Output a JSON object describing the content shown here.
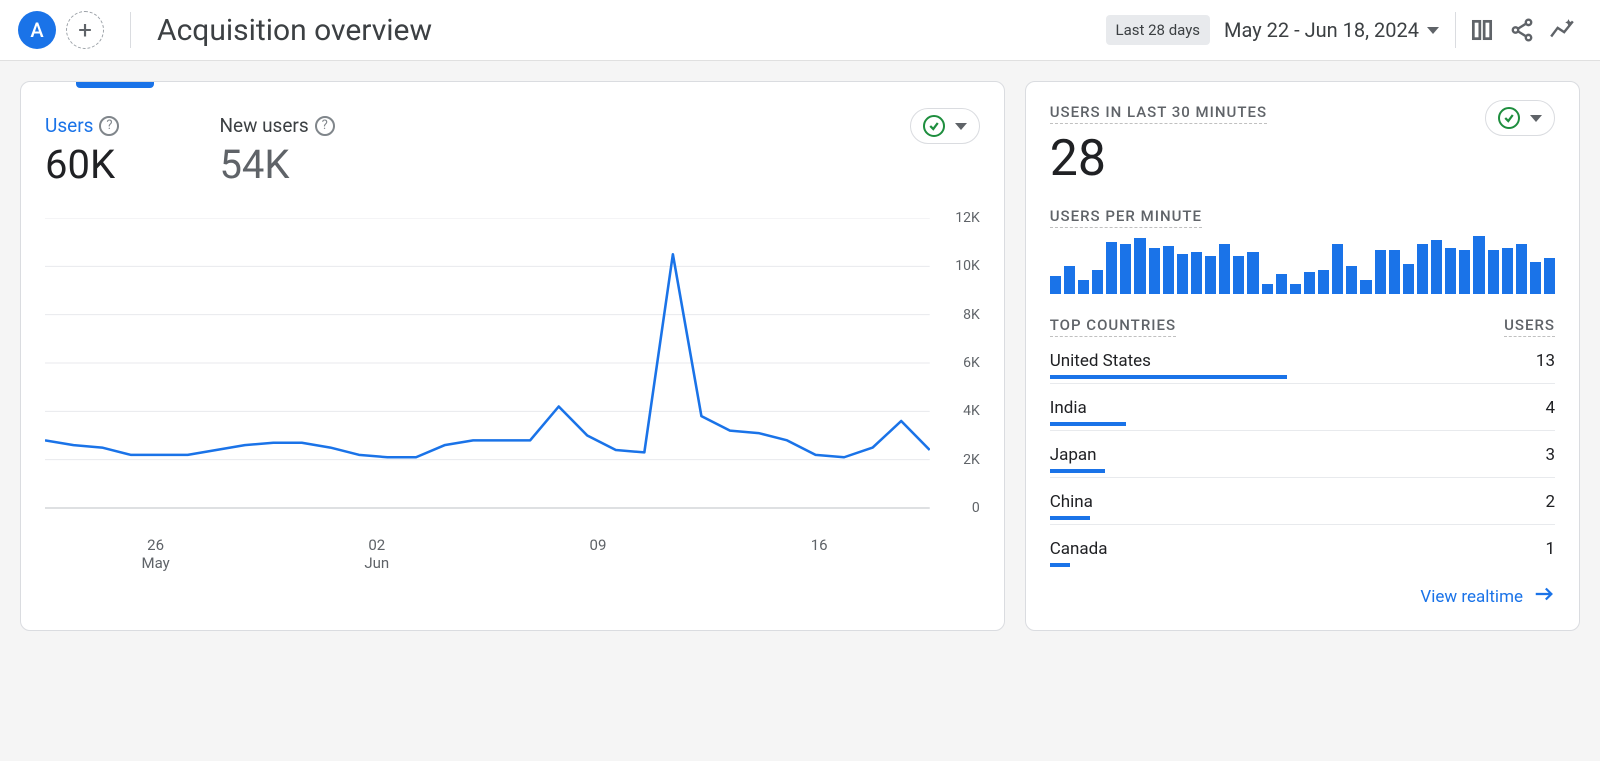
{
  "header": {
    "avatar_letter": "A",
    "title": "Acquisition overview",
    "date_chip": "Last 28 days",
    "date_range": "May 22 - Jun 18, 2024"
  },
  "colors": {
    "primary": "#1a73e8",
    "success": "#1e8e3e"
  },
  "metrics": {
    "users": {
      "label": "Users",
      "value": "60K"
    },
    "new_users": {
      "label": "New users",
      "value": "54K"
    }
  },
  "realtime": {
    "title": "USERS IN LAST 30 MINUTES",
    "value": "28",
    "per_minute_title": "USERS PER MINUTE",
    "bars": [
      18,
      28,
      14,
      24,
      52,
      50,
      56,
      46,
      48,
      40,
      42,
      38,
      50,
      38,
      42,
      10,
      20,
      10,
      22,
      24,
      50,
      28,
      14,
      44,
      44,
      30,
      50,
      54,
      46,
      44,
      58,
      44,
      46,
      50,
      32,
      36
    ],
    "top_title": "TOP COUNTRIES",
    "users_title": "USERS",
    "countries": [
      {
        "name": "United States",
        "users": 13,
        "bar": 47
      },
      {
        "name": "India",
        "users": 4,
        "bar": 15
      },
      {
        "name": "Japan",
        "users": 3,
        "bar": 11
      },
      {
        "name": "China",
        "users": 2,
        "bar": 8
      },
      {
        "name": "Canada",
        "users": 1,
        "bar": 4
      }
    ],
    "view_link": "View realtime"
  },
  "chart_data": {
    "type": "line",
    "title": "",
    "xlabel": "",
    "ylabel": "",
    "ylim": [
      0,
      12000
    ],
    "y_ticks": [
      "12K",
      "10K",
      "8K",
      "6K",
      "4K",
      "2K",
      "0"
    ],
    "x_ticks": [
      {
        "day": "26",
        "month": "May"
      },
      {
        "day": "02",
        "month": "Jun"
      },
      {
        "day": "09",
        "month": ""
      },
      {
        "day": "16",
        "month": ""
      }
    ],
    "x": [
      "May 22",
      "May 23",
      "May 24",
      "May 25",
      "May 26",
      "May 27",
      "May 28",
      "May 29",
      "May 30",
      "May 31",
      "Jun 01",
      "Jun 02",
      "Jun 03",
      "Jun 04",
      "Jun 05",
      "Jun 06",
      "Jun 07",
      "Jun 08",
      "Jun 09",
      "Jun 10",
      "Jun 11",
      "Jun 12",
      "Jun 13",
      "Jun 14",
      "Jun 15",
      "Jun 16",
      "Jun 17",
      "Jun 18"
    ],
    "series": [
      {
        "name": "Users",
        "values": [
          2800,
          2600,
          2500,
          2200,
          2200,
          2200,
          2400,
          2600,
          2700,
          2700,
          2500,
          2200,
          2100,
          2100,
          2600,
          2800,
          2800,
          2800,
          4200,
          3000,
          2400,
          2300,
          10500,
          3800,
          3200,
          3100,
          2800,
          2200,
          2100,
          2500,
          3600,
          2400
        ]
      }
    ]
  }
}
